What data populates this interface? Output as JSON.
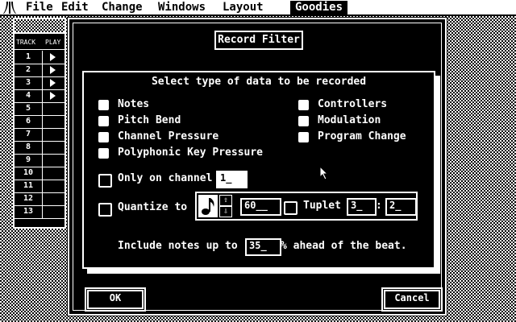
{
  "menubar": {
    "items": [
      "File",
      "Edit",
      "Change",
      "Windows",
      "Layout",
      "Goodies"
    ],
    "active": "Goodies"
  },
  "track_window": {
    "header_track": "TRACK",
    "header_play": "PLAY",
    "rows": [
      "1",
      "2",
      "3",
      "4",
      "5",
      "6",
      "7",
      "8",
      "9",
      "10",
      "11",
      "12",
      "13"
    ],
    "playing_rows": 4
  },
  "dialog": {
    "title": "Record Filter",
    "subtitle": "Select type of data to be recorded",
    "options_left": [
      "Notes",
      "Pitch Bend",
      "Channel Pressure",
      "Polyphonic Key Pressure"
    ],
    "options_right": [
      "Controllers",
      "Modulation",
      "Program Change"
    ],
    "only_channel_label": "Only on channel",
    "only_channel_value": "1_",
    "quantize_label": "Quantize to",
    "quantize_note_icon": "eighth-note-icon",
    "quantize_value": "60__",
    "tuplet_label": "Tuplet",
    "tuplet_a": "3_",
    "tuplet_sep": ":",
    "tuplet_b": "2_",
    "include_prefix": "Include notes up to",
    "include_value": "35_",
    "include_suffix": "% ahead of the beat.",
    "ok_label": "OK",
    "cancel_label": "Cancel"
  }
}
